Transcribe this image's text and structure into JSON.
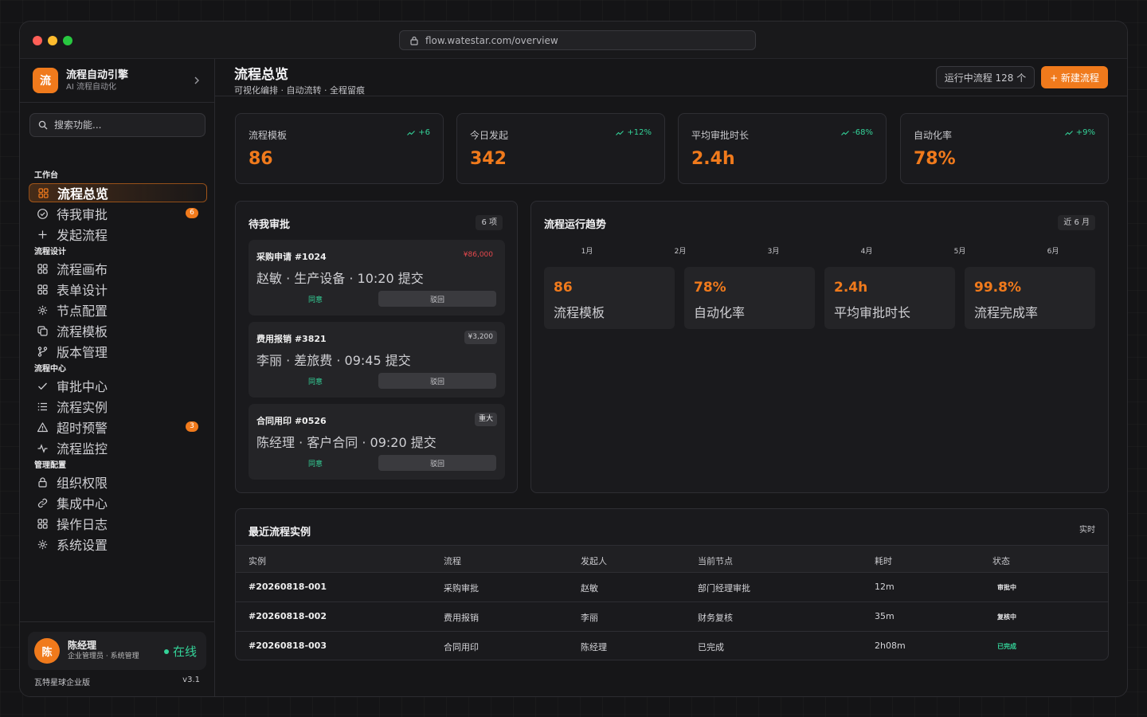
{
  "browser": {
    "url": "flow.watestar.com/overview"
  },
  "brand": {
    "logo": "流",
    "title": "流程自动引擎",
    "subtitle": "AI 流程自动化"
  },
  "search": {
    "placeholder": "搜索功能..."
  },
  "sidebar": {
    "sections": [
      "工作台",
      "流程设计",
      "流程中心",
      "管理配置"
    ],
    "items": [
      {
        "label": "流程总览",
        "icon": "grid-icon"
      },
      {
        "label": "待我审批",
        "icon": "check-circle-icon",
        "badge": "6"
      },
      {
        "label": "发起流程",
        "icon": "plus-icon"
      },
      {
        "label": "流程画布",
        "icon": "grid-icon"
      },
      {
        "label": "表单设计",
        "icon": "grid-icon"
      },
      {
        "label": "节点配置",
        "icon": "gear-icon"
      },
      {
        "label": "流程模板",
        "icon": "copy-icon"
      },
      {
        "label": "版本管理",
        "icon": "branch-icon"
      },
      {
        "label": "审批中心",
        "icon": "check-icon"
      },
      {
        "label": "流程实例",
        "icon": "list-icon"
      },
      {
        "label": "超时预警",
        "icon": "warning-icon",
        "badge": "3"
      },
      {
        "label": "流程监控",
        "icon": "pulse-icon"
      },
      {
        "label": "组织权限",
        "icon": "lock-icon"
      },
      {
        "label": "集成中心",
        "icon": "link-icon"
      },
      {
        "label": "操作日志",
        "icon": "grid-icon"
      },
      {
        "label": "系统设置",
        "icon": "gear-icon"
      }
    ]
  },
  "user": {
    "avatar": "陈",
    "name": "陈经理",
    "role": "企业管理员 · 系统管理",
    "status": "在线"
  },
  "footer": {
    "edition": "瓦特星球企业版",
    "version": "v3.1"
  },
  "header": {
    "title": "流程总览",
    "subtitle": "可视化编排 · 自动流转 · 全程留痕",
    "running": "运行中流程 128 个",
    "new_button": "+ 新建流程"
  },
  "kpis": [
    {
      "label": "流程模板",
      "value": "86",
      "trend": "+6"
    },
    {
      "label": "今日发起",
      "value": "342",
      "trend": "+12%"
    },
    {
      "label": "平均审批时长",
      "value": "2.4h",
      "trend": "-68%"
    },
    {
      "label": "自动化率",
      "value": "78%",
      "trend": "+9%"
    }
  ],
  "pending": {
    "title": "待我审批",
    "count": "6 项",
    "approve_label": "同意",
    "reject_label": "驳回",
    "items": [
      {
        "title": "采购申请 #1024",
        "tag": "¥86,000",
        "tag_color": "#e5484d",
        "desc": "赵敏 · 生产设备 · 10:20 提交"
      },
      {
        "title": "费用报销 #3821",
        "tag": "¥3,200",
        "tag_color": "#c8c8cc",
        "desc": "李丽 · 差旅费 · 09:45 提交"
      },
      {
        "title": "合同用印 #0526",
        "tag": "重大",
        "tag_color": "#e6e6e8",
        "desc": "陈经理 · 客户合同 · 09:20 提交"
      }
    ]
  },
  "trend": {
    "title": "流程运行趋势",
    "range": "近 6 月",
    "months": [
      "1月",
      "2月",
      "3月",
      "4月",
      "5月",
      "6月"
    ],
    "stats": [
      {
        "value": "86",
        "label": "流程模板"
      },
      {
        "value": "78%",
        "label": "自动化率"
      },
      {
        "value": "2.4h",
        "label": "平均审批时长"
      },
      {
        "value": "99.8%",
        "label": "流程完成率"
      }
    ]
  },
  "recent": {
    "title": "最近流程实例",
    "realtime": "实时",
    "columns": [
      "实例",
      "流程",
      "发起人",
      "当前节点",
      "耗时",
      "状态"
    ],
    "rows": [
      {
        "id": "#20260818-001",
        "flow": "采购审批",
        "initiator": "赵敏",
        "node": "部门经理审批",
        "time": "12m",
        "status": "审批中",
        "status_color": "#e6e6e8"
      },
      {
        "id": "#20260818-002",
        "flow": "费用报销",
        "initiator": "李丽",
        "node": "财务复核",
        "time": "35m",
        "status": "复核中",
        "status_color": "#e6e6e8"
      },
      {
        "id": "#20260818-003",
        "flow": "合同用印",
        "initiator": "陈经理",
        "node": "已完成",
        "time": "2h08m",
        "status": "已完成",
        "status_color": "#34d399"
      }
    ]
  },
  "colors": {
    "accent": "#f07a1c",
    "success": "#34d399",
    "danger": "#e5484d"
  }
}
